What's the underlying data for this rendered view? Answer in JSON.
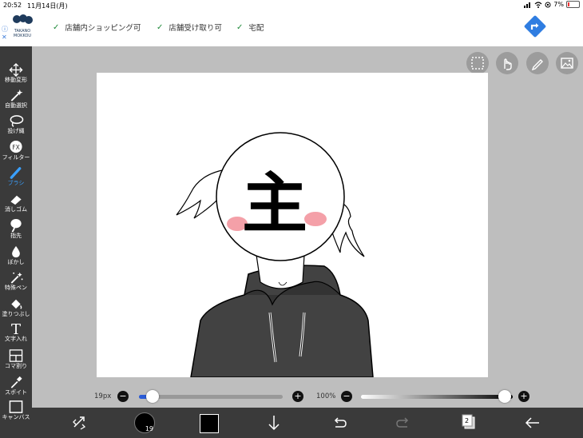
{
  "statusbar": {
    "time": "20:52",
    "date": "11月14日(月)",
    "battery": "7%"
  },
  "ad": {
    "brand_line1": "TAKANO",
    "brand_line2": "MOKKOU",
    "info_icon": "info-icon",
    "close_icon": "close-x-icon",
    "features": [
      "店舗内ショッピング可",
      "店舗受け取り可",
      "宅配"
    ]
  },
  "tools": [
    {
      "label": "移動変形",
      "icon": "move-arrows-icon"
    },
    {
      "label": "自動選択",
      "icon": "magic-wand-icon"
    },
    {
      "label": "投げ縄",
      "icon": "lasso-icon"
    },
    {
      "label": "フィルター",
      "icon": "fx-icon",
      "glyph": "FX"
    },
    {
      "label": "ブラシ",
      "icon": "brush-icon",
      "active": true
    },
    {
      "label": "消しゴム",
      "icon": "eraser-icon"
    },
    {
      "label": "指先",
      "icon": "finger-smudge-icon"
    },
    {
      "label": "ぼかし",
      "icon": "blur-drop-icon"
    },
    {
      "label": "特殊ペン",
      "icon": "special-pen-icon"
    },
    {
      "label": "塗りつぶし",
      "icon": "fill-bucket-icon"
    },
    {
      "label": "文字入れ",
      "icon": "text-icon",
      "glyph": "T"
    },
    {
      "label": "コマ割り",
      "icon": "frame-divide-icon"
    },
    {
      "label": "スポイト",
      "icon": "eyedropper-icon"
    },
    {
      "label": "キャンバス",
      "icon": "canvas-icon"
    }
  ],
  "canvas": {
    "character": "主"
  },
  "brush_size": {
    "label": "19px",
    "level": 0.04
  },
  "opacity": {
    "label": "100%",
    "level": 1.0
  },
  "bottom": {
    "brush_size_badge": "19",
    "layer_count": "2"
  },
  "colors": {
    "accent": "#3aa0ff",
    "toolbar_bg": "#3a3a3a",
    "canvas_bg": "#bebebe"
  }
}
